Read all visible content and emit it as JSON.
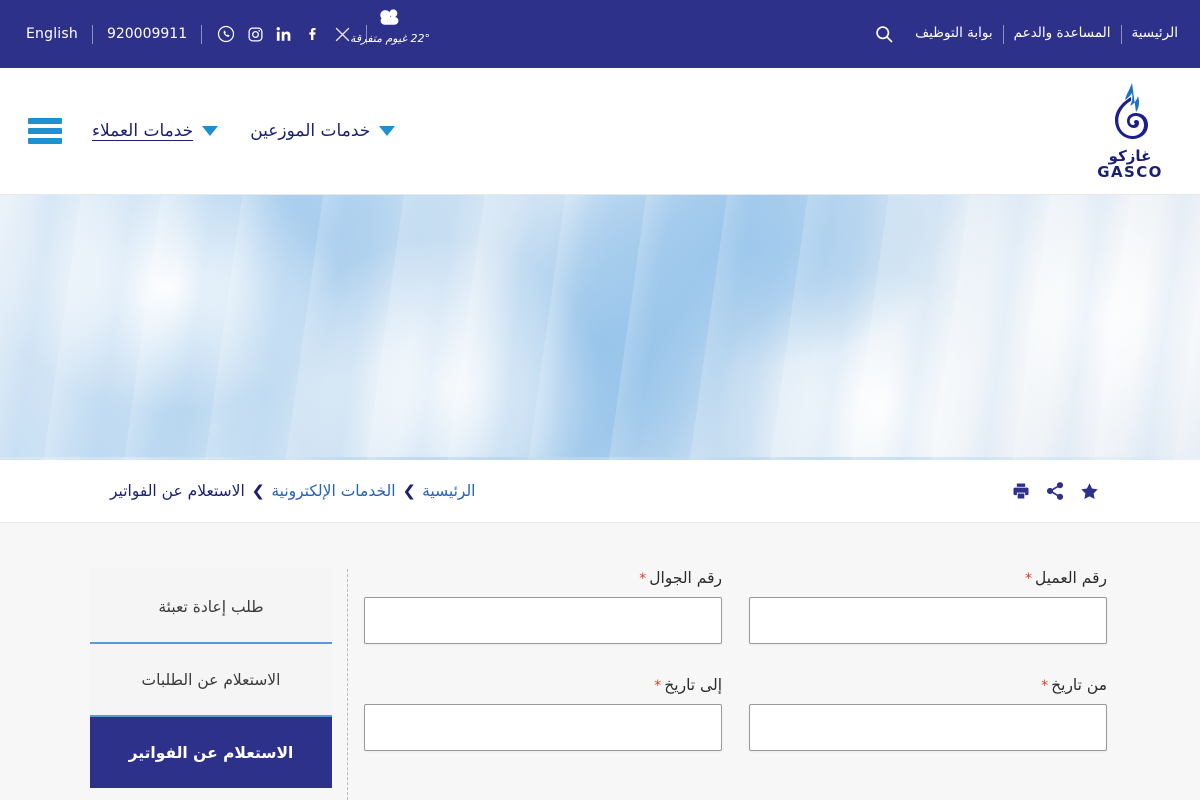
{
  "topbar": {
    "language_label": "English",
    "phone": "920009911",
    "social": [
      {
        "name": "whatsapp-icon",
        "label": "WhatsApp"
      },
      {
        "name": "instagram-icon",
        "label": "Instagram"
      },
      {
        "name": "linkedin-icon",
        "label": "LinkedIn"
      },
      {
        "name": "facebook-icon",
        "label": "Facebook"
      },
      {
        "name": "x-twitter-icon",
        "label": "X"
      }
    ],
    "weather": {
      "temperature": "22°",
      "condition": "غيوم متفرقة",
      "icon": "cloud-icon"
    },
    "links": [
      {
        "label": "الرئيسية"
      },
      {
        "label": "المساعدة والدعم"
      },
      {
        "label": "بوابة التوظيف"
      }
    ],
    "search_icon": "search-icon"
  },
  "brand": {
    "logo_icon": "gasco-flame-logo",
    "name_ar": "غازكو",
    "name_en": "GASCO"
  },
  "nav": {
    "menu_icon": "hamburger-menu-icon",
    "items": [
      {
        "label": "خدمات العملاء",
        "active": true
      },
      {
        "label": "خدمات الموزعين",
        "active": false
      }
    ]
  },
  "breadcrumb": {
    "items": [
      {
        "label": "الرئيسية",
        "current": false
      },
      {
        "label": "الخدمات الإلكترونية",
        "current": false
      },
      {
        "label": "الاستعلام عن الفواتير",
        "current": true
      }
    ],
    "separator": "❯",
    "actions": [
      {
        "name": "print-icon",
        "label": "طباعة"
      },
      {
        "name": "share-icon",
        "label": "مشاركة"
      },
      {
        "name": "favorite-star-icon",
        "label": "المفضلة"
      }
    ]
  },
  "tabs": [
    {
      "label": "طلب إعادة تعبئة",
      "active": false
    },
    {
      "label": "الاستعلام عن الطلبات",
      "active": false
    },
    {
      "label": "الاستعلام عن الفواتير",
      "active": true
    }
  ],
  "form": {
    "rows": [
      [
        {
          "label": "رقم العميل",
          "required": "*",
          "value": "",
          "placeholder": ""
        },
        {
          "label": "رقم الجوال",
          "required": "*",
          "value": "",
          "placeholder": ""
        }
      ],
      [
        {
          "label": "من تاريخ",
          "required": "*",
          "value": "",
          "placeholder": ""
        },
        {
          "label": "إلى تاريخ",
          "required": "*",
          "value": "",
          "placeholder": ""
        }
      ]
    ]
  },
  "colors": {
    "navy": "#2d3189",
    "accent_blue": "#1e90d0",
    "light_blue": "#5b9bd5",
    "link_blue": "#2563b8",
    "required_red": "#e03a2f",
    "panel_bg": "#f7f7f7"
  }
}
